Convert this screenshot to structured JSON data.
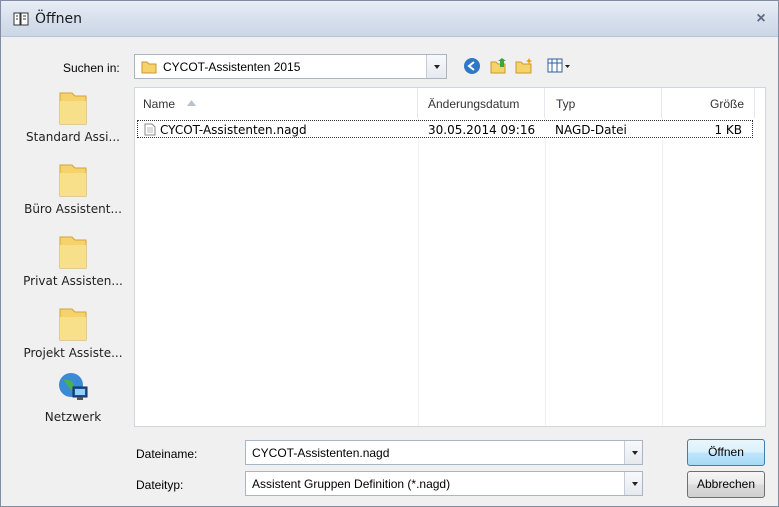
{
  "window": {
    "title": "Öffnen",
    "close_glyph": "×"
  },
  "lookin": {
    "label": "Suchen in:",
    "value": "CYCOT-Assistenten 2015"
  },
  "toolbar": {
    "icons": [
      "back-icon",
      "up-folder-icon",
      "new-folder-icon",
      "view-menu-icon"
    ]
  },
  "places": [
    {
      "label": "Standard Assi...",
      "icon": "folder-icon"
    },
    {
      "label": "Büro Assistent...",
      "icon": "folder-icon"
    },
    {
      "label": "Privat Assisten...",
      "icon": "folder-icon"
    },
    {
      "label": "Projekt Assiste...",
      "icon": "folder-icon"
    },
    {
      "label": "Netzwerk",
      "icon": "network-icon"
    }
  ],
  "filelist": {
    "columns": [
      "Name",
      "Änderungsdatum",
      "Typ",
      "Größe"
    ],
    "rows": [
      {
        "name": "CYCOT-Assistenten.nagd",
        "modified": "30.05.2014 09:16",
        "type": "NAGD-Datei",
        "size": "1 KB"
      }
    ]
  },
  "form": {
    "filename_label": "Dateiname:",
    "filename_value": "CYCOT-Assistenten.nagd",
    "filetype_label": "Dateityp:",
    "filetype_value": "Assistent Gruppen Definition (*.nagd)"
  },
  "buttons": {
    "open": "Öffnen",
    "cancel": "Abbrechen"
  },
  "colors": {
    "title_gradient_top": "#e9eef6",
    "button_primary": "#bee6fd",
    "folder": "#f5d36a"
  }
}
